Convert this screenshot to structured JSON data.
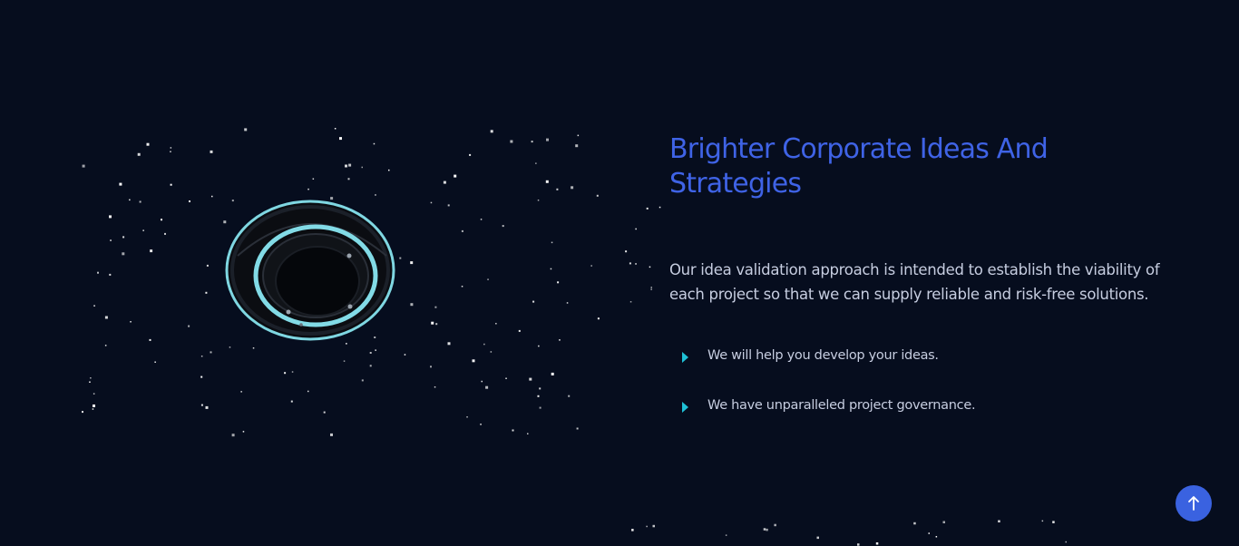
{
  "section": {
    "heading": "Brighter Corporate Ideas And Strategies",
    "description": "Our idea validation approach is intended to establish the viability of each project so that we can supply reliable and risk-free solutions.",
    "features": [
      {
        "label": "We will help you develop your ideas.",
        "icon": "caret-right-icon"
      },
      {
        "label": "We have unparalleled project governance.",
        "icon": "caret-right-icon"
      }
    ]
  },
  "scroll_top": {
    "icon": "arrow-up-icon"
  },
  "colors": {
    "background": "#060d1e",
    "heading": "#3f63e6",
    "body_text": "#c6cde0",
    "accent": "#1fc0d6",
    "button": "#3a62e0"
  }
}
